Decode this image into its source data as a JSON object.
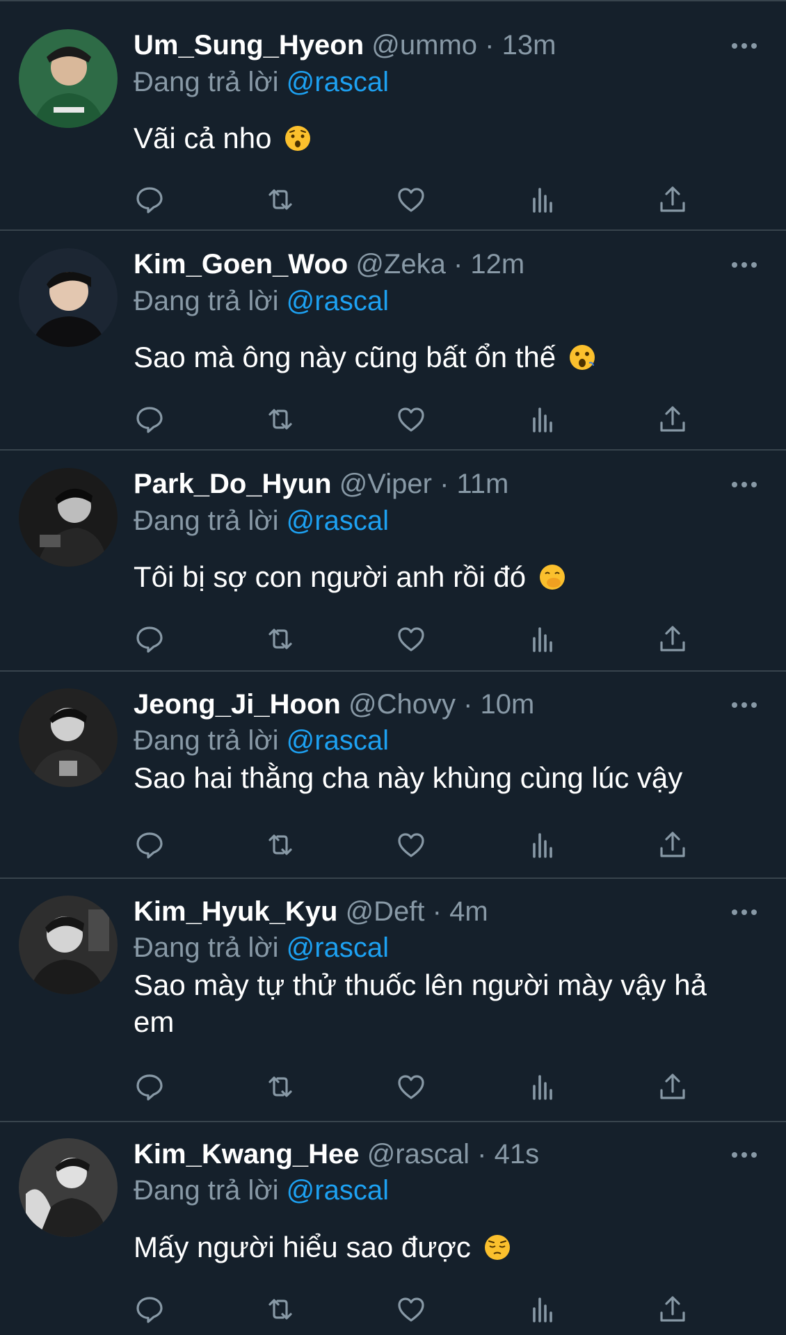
{
  "reply_prefix": "Đang trả lời",
  "tweets": [
    {
      "display_name": "Um_Sung_Hyeon",
      "handle": "@ummo",
      "separator": "·",
      "time": "13m",
      "reply_to": "@rascal",
      "text": "Vãi cả nho",
      "emoji": "worried-face-emoji",
      "avatar_color": "#2e6b46"
    },
    {
      "display_name": "Kim_Goen_Woo",
      "handle": "@Zeka",
      "separator": "·",
      "time": "12m",
      "reply_to": "@rascal",
      "text": "Sao mà ông này cũng bất ổn thế",
      "emoji": "face-with-open-mouth-emoji",
      "avatar_color": "#1c2633"
    },
    {
      "display_name": "Park_Do_Hyun",
      "handle": "@Viper",
      "separator": "·",
      "time": "11m",
      "reply_to": "@rascal",
      "text": "Tôi bị sợ con người anh rồi đó",
      "emoji": "face-with-hand-over-mouth-emoji",
      "avatar_color": "#2b2b2b"
    },
    {
      "display_name": "Jeong_Ji_Hoon",
      "handle": "@Chovy",
      "separator": "·",
      "time": "10m",
      "reply_to": "@rascal",
      "text": "Sao hai thằng cha này khùng cùng lúc vậy",
      "emoji": "",
      "avatar_color": "#333333"
    },
    {
      "display_name": "Kim_Hyuk_Kyu",
      "handle": "@Deft",
      "separator": "·",
      "time": "4m",
      "reply_to": "@rascal",
      "text": "Sao mày tự thử thuốc lên người mày vậy hả em",
      "emoji": "",
      "avatar_color": "#3a3a3a"
    },
    {
      "display_name": "Kim_Kwang_Hee",
      "handle": "@rascal",
      "separator": "·",
      "time": "41s",
      "reply_to": "@rascal",
      "text": "Mấy người hiểu sao được",
      "emoji": "pensive-face-emoji",
      "avatar_color": "#444444"
    }
  ],
  "colors": {
    "background": "#15202b",
    "divider": "#38444d",
    "secondary_text": "#8899a6",
    "mention": "#1da1f2",
    "emoji_yellow": "#fbc02d"
  },
  "action_icons": [
    "reply-icon",
    "retweet-icon",
    "like-icon",
    "analytics-icon",
    "share-icon"
  ]
}
